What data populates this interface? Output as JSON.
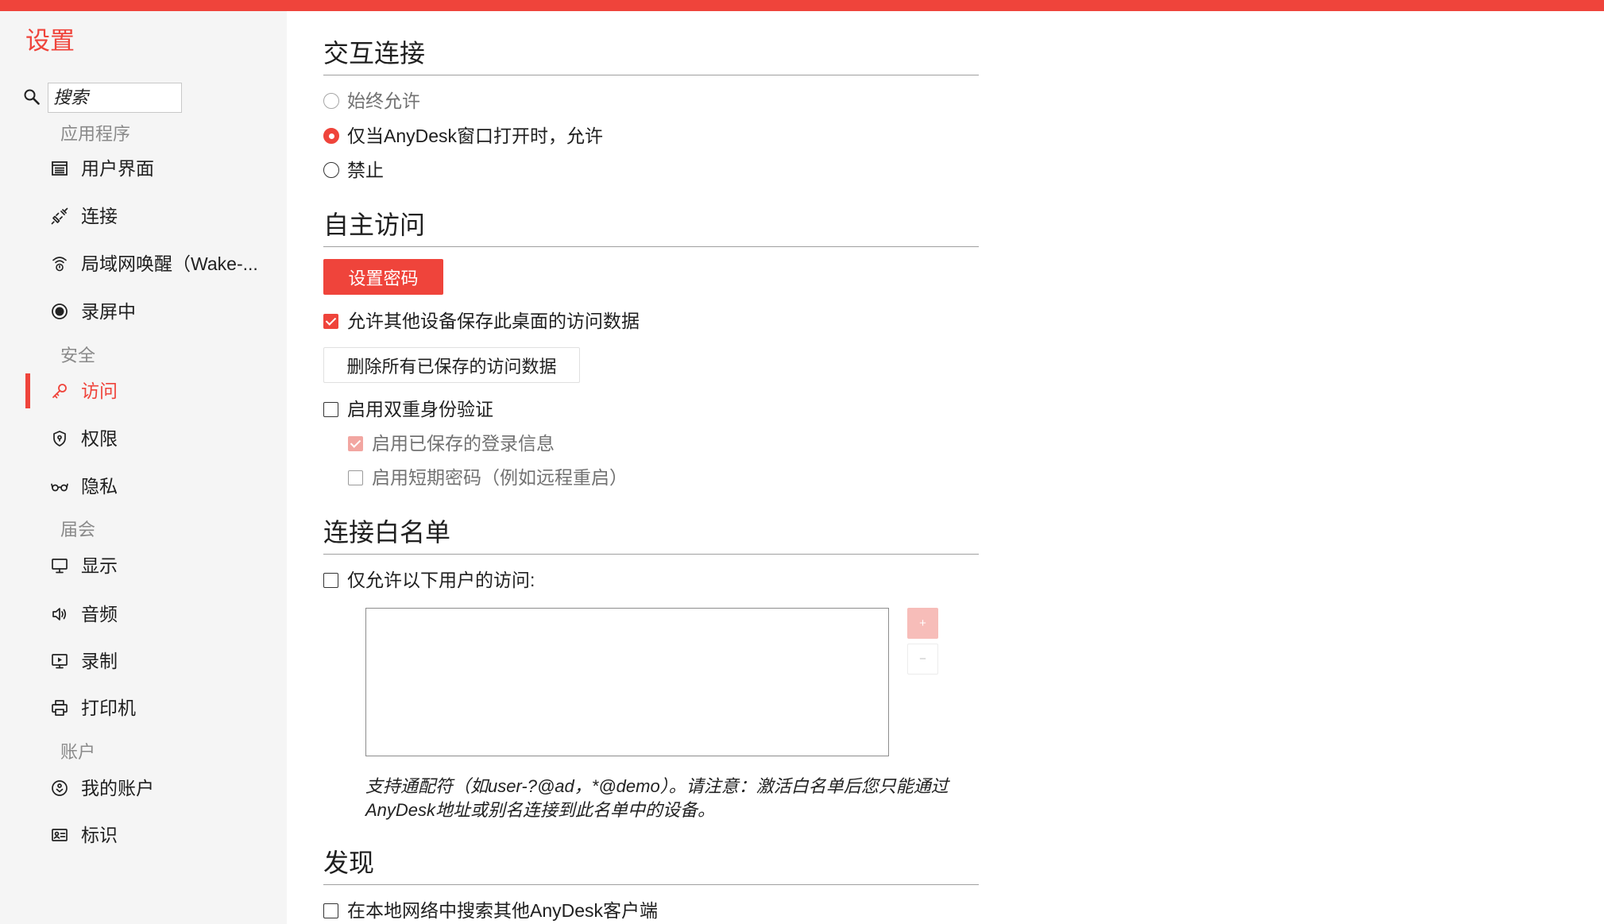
{
  "theme": {
    "accent": "#ef443b",
    "accent_faded": "#f7bdb9",
    "accent_disabled": "#f2a6a1",
    "sidebar_bg": "#f5f5f5",
    "text": "#1f1f1f",
    "muted": "#727272"
  },
  "sidebar": {
    "title": "设置",
    "search": {
      "placeholder": "搜索",
      "icon": "search-icon"
    },
    "sections": [
      {
        "label": "应用程序",
        "items": [
          {
            "label": "用户界面",
            "icon": "user-interface-icon"
          },
          {
            "label": "连接",
            "icon": "plug-icon"
          },
          {
            "label": "局域网唤醒（Wake-...",
            "icon": "wifi-icon"
          },
          {
            "label": "录屏中",
            "icon": "record-icon"
          }
        ]
      },
      {
        "label": "安全",
        "items": [
          {
            "label": "访问",
            "icon": "key-icon",
            "active": true
          },
          {
            "label": "权限",
            "icon": "shield-icon"
          },
          {
            "label": "隐私",
            "icon": "glasses-icon"
          }
        ]
      },
      {
        "label": "届会",
        "items": [
          {
            "label": "显示",
            "icon": "monitor-icon"
          },
          {
            "label": "音频",
            "icon": "speaker-icon"
          },
          {
            "label": "录制",
            "icon": "playback-icon"
          },
          {
            "label": "打印机",
            "icon": "printer-icon"
          }
        ]
      },
      {
        "label": "账户",
        "items": [
          {
            "label": "我的账户",
            "icon": "account-icon"
          },
          {
            "label": "标识",
            "icon": "id-card-icon"
          }
        ]
      }
    ]
  },
  "main": {
    "interactive": {
      "title": "交互连接",
      "options": [
        {
          "label": "始终允许",
          "checked": false,
          "disabled": true
        },
        {
          "label": "仅当AnyDesk窗口打开时，允许",
          "checked": true,
          "disabled": false
        },
        {
          "label": "禁止",
          "checked": false,
          "disabled": false
        }
      ]
    },
    "unattended": {
      "title": "自主访问",
      "set_password_label": "设置密码",
      "allow_save": {
        "label": "允许其他设备保存此桌面的访问数据",
        "checked": true,
        "disabled": false
      },
      "delete_saved_label": "删除所有已保存的访问数据",
      "two_factor": {
        "label": "启用双重身份验证",
        "checked": false,
        "disabled": false
      },
      "saved_login": {
        "label": "启用已保存的登录信息",
        "checked": true,
        "disabled": true
      },
      "short_password": {
        "label": "启用短期密码（例如远程重启）",
        "checked": false,
        "disabled": true
      }
    },
    "whitelist": {
      "title": "连接白名单",
      "only_allow": {
        "label": "仅允许以下用户的访问:",
        "checked": false,
        "disabled": false
      },
      "entries": [],
      "add_label": "+",
      "remove_label": "−",
      "note_lines": [
        "支持通配符（如user-?@ad，*@demo）。请注意：激活白名单后您只能通过",
        "AnyDesk地址或别名连接到此名单中的设备。"
      ]
    },
    "discovery": {
      "title": "发现",
      "search_local": {
        "label": "在本地网络中搜索其他AnyDesk客户端",
        "checked": false,
        "disabled": false
      }
    }
  }
}
